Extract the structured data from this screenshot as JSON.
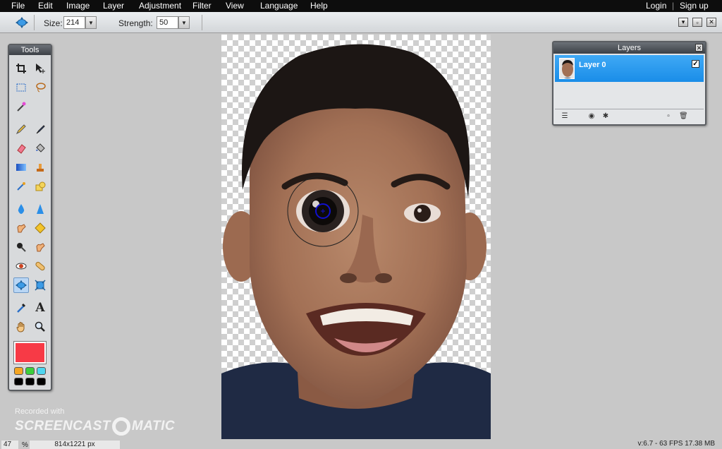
{
  "menubar": {
    "items": [
      "File",
      "Edit",
      "Image",
      "Layer",
      "Adjustment",
      "Filter",
      "View",
      "Language",
      "Help"
    ],
    "login": "Login",
    "signup": "Sign up"
  },
  "options": {
    "size_label": "Size:",
    "size_value": "214",
    "strength_label": "Strength:",
    "strength_value": "50"
  },
  "tools": {
    "title": "Tools",
    "primary_color": "#f73a46",
    "palette": [
      "#f5a623",
      "#3ccf3c",
      "#4fd6f0",
      "#000000",
      "#000000",
      "#000000"
    ]
  },
  "layers": {
    "title": "Layers",
    "items": [
      {
        "name": "Layer 0",
        "visible": true
      }
    ]
  },
  "watermark": {
    "recorded": "Recorded with",
    "brand_left": "SCREENCAST",
    "brand_right": "MATIC"
  },
  "status": {
    "zoom": "47",
    "zoom_unit": "%",
    "dimensions": "814x1221 px",
    "info": "v:6.7 - 63 FPS 17.38 MB"
  },
  "colors": {
    "accent": "#1a8de8",
    "menubar": "#0d0d0d"
  }
}
